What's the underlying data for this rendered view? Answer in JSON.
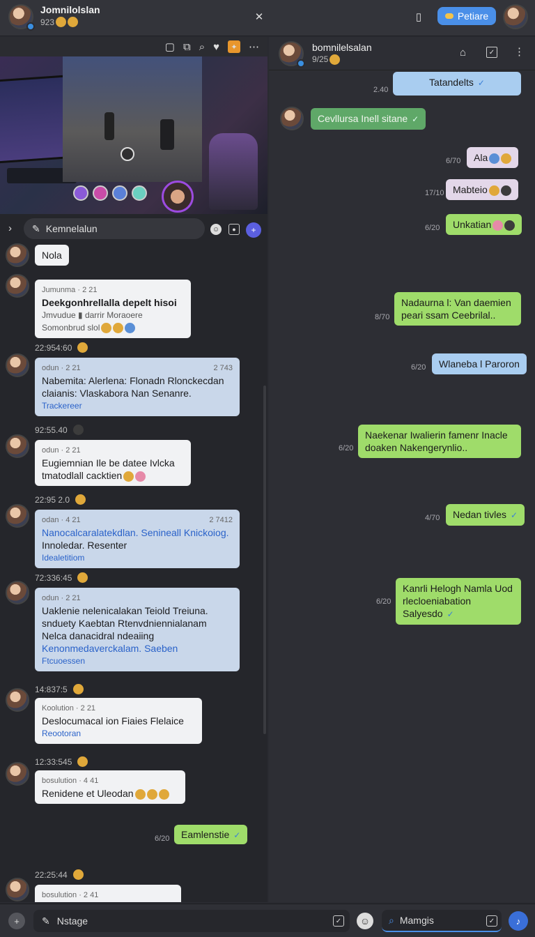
{
  "header": {
    "title": "Jomnilolslan",
    "subtitle": "923",
    "action_label": "Petiare"
  },
  "video_panel": {
    "search_placeholder": "Kemnelalun"
  },
  "left_messages": [
    {
      "text": "Nola"
    },
    {
      "meta": "Jumunma · 2 21",
      "line1": "Deekgonhrellalla depelt hisoi",
      "line2": "Jmvudue ▮ darrir Moraoere",
      "line3": "Somonbrud slol"
    },
    {
      "ts": "22:954:60",
      "meta": "odun · 2 21",
      "meta_right": "2 743",
      "line1": "Nabemita: Alerlena: Flonadn Rlonckecdan",
      "line2": "claianis: Vlaskabora Nan Senanre.",
      "link": "Trackereer"
    },
    {
      "ts": "92:55.40",
      "meta": "odun · 2 21",
      "line1": "Eugiemnian Ile be datee Ivlcka",
      "line2": "tmatodlall cacktien"
    },
    {
      "ts": "22:95 2.0",
      "meta": "odan · 4 21",
      "meta_right": "2 7412",
      "line1": "Nanocalcaralatekdlan. Senineall Knickoiog.",
      "line2": "Innoledar. Resenter",
      "link": "Idealetitiom"
    },
    {
      "ts": "72:336:45",
      "meta": "odun · 2 21",
      "line1": "Uaklenie nelenicalakan Teiold Treiuna.",
      "line2": "snduety Kaebtan Rtenvdniennialanam",
      "line3": "Nelca danacidral ndeaiing",
      "line4": "Kenonmedaverckalam. Saeben",
      "link": "Ftcuoessen"
    },
    {
      "ts": "14:837:5",
      "meta": "Koolution · 2 21",
      "line1": "Deslocumacal ion Fiaies Flelaice",
      "link": "Reootoran"
    },
    {
      "ts": "12:33:545",
      "meta": "bosulution · 4 41",
      "line1": "Renidene et Uleodan"
    },
    {
      "ts": "22:25:44",
      "meta": "bosulution · 2 41"
    }
  ],
  "left_outgoing": {
    "text": "Eamlenstie",
    "time": "6/20"
  },
  "right_panel": {
    "contact_name": "bomnilelsalan",
    "contact_sub": "9/25",
    "messages": [
      {
        "text": "Tatandelts",
        "time": "2.40"
      },
      {
        "text": "Cevllursa Inell sitane"
      },
      {
        "text": "Ala",
        "time": "6/70"
      },
      {
        "text": "Mabteio",
        "time": "17/10"
      },
      {
        "text": "Unkatian",
        "time": "6/20"
      },
      {
        "text": "Nadaurna l: Van daemien peari ssam Ceebrilal..",
        "time": "8/70"
      },
      {
        "text": "Wlaneba l Paroron",
        "time": "6/20"
      },
      {
        "text": "Naekenar Iwalierin famenr Inacle doaken Nakengerynlio..",
        "time": "6/20"
      },
      {
        "text": "Nedan tivles",
        "time": "4/70"
      },
      {
        "text": "Kanrli Helogh Namla Uod rlecloeniabation Salyesdo",
        "time": "6/20"
      }
    ]
  },
  "bottom": {
    "compose_placeholder": "Nstage",
    "search_label": "Mamgis"
  }
}
